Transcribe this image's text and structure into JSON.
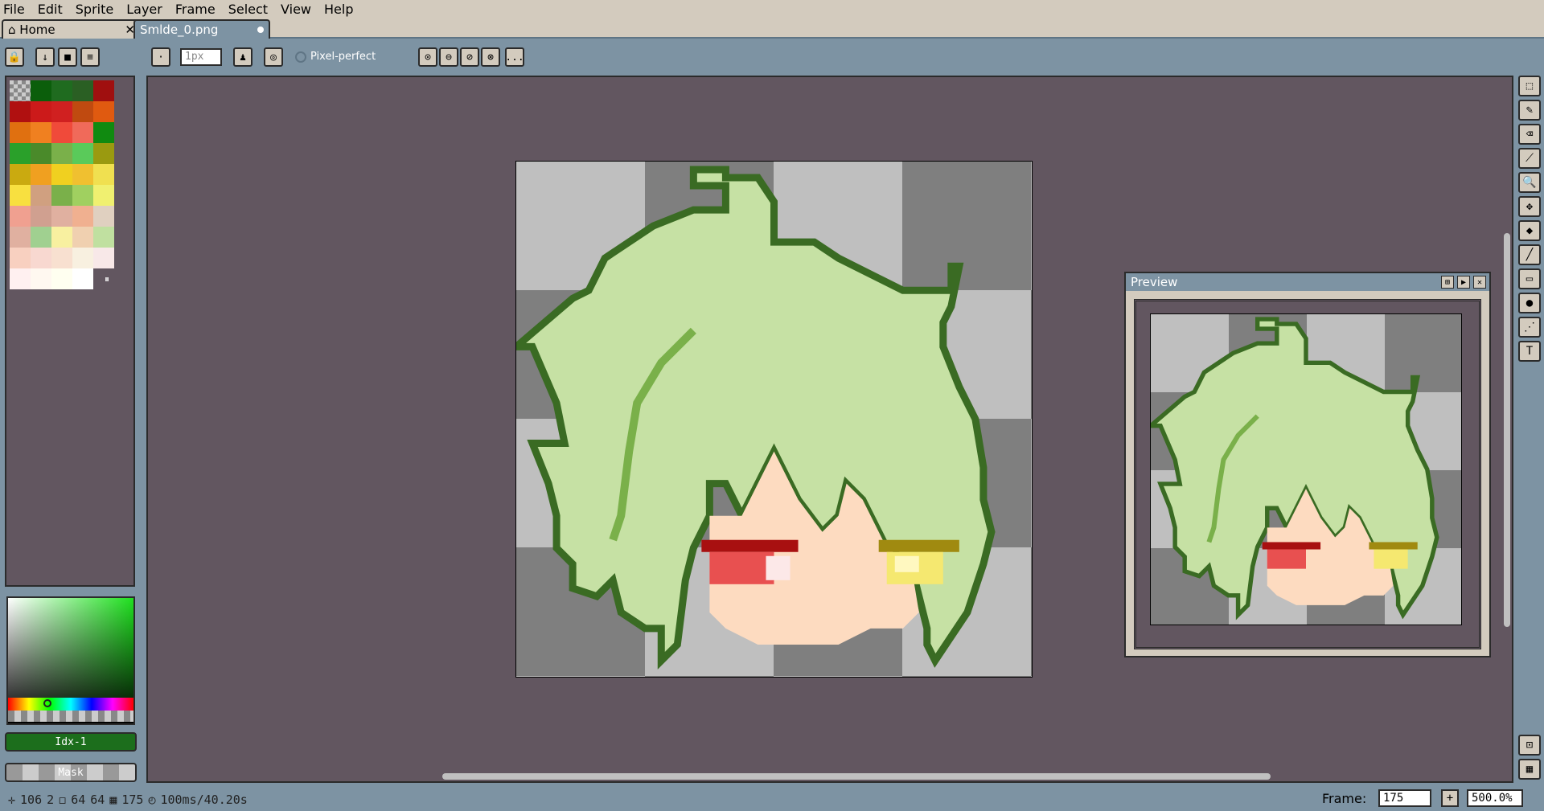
{
  "menu": {
    "items": [
      "File",
      "Edit",
      "Sprite",
      "Layer",
      "Frame",
      "Select",
      "View",
      "Help"
    ]
  },
  "tabs": {
    "home_label": "Home",
    "file_label": "Smlde_0.png",
    "home_close": "✕"
  },
  "toolbar": {
    "brush_size_placeholder": "1px",
    "pixel_perfect_label": "Pixel-perfect",
    "more_label": "..."
  },
  "palette": {
    "colors": [
      "#bfbfbf",
      "#0b5e0b",
      "#1f6b1f",
      "#2a5f23",
      "#a00f0f",
      "#b01010",
      "#cc1a1a",
      "#d02020",
      "#c04a10",
      "#e05a10",
      "#e07010",
      "#f08020",
      "#f04a3a",
      "#f06a5a",
      "#108a10",
      "#2aa02a",
      "#4a8a2a",
      "#7ab04a",
      "#5aca5a",
      "#9a9a10",
      "#caaa10",
      "#f0a020",
      "#f0d020",
      "#f0c030",
      "#f0e050",
      "#f8e040",
      "#d0a080",
      "#7ab04a",
      "#a0d060",
      "#f0f070",
      "#f0a090",
      "#d0a090",
      "#e0b0a0",
      "#f0b090",
      "#e0d0c0",
      "#e0b0a0",
      "#a0d090",
      "#f8f0a0",
      "#f0d0b0",
      "#c0e0a0",
      "#f8d0c0",
      "#f8d8d0",
      "#f8e0d0",
      "#f8f0e0",
      "#f8e8e8",
      "#fff0f0",
      "#fff8f0",
      "#fffff0",
      "#ffffff"
    ]
  },
  "color_panel": {
    "index_label": "Idx-1",
    "mask_label": "Mask"
  },
  "preview": {
    "title": "Preview"
  },
  "status": {
    "pos_x": "106",
    "pos_y": "2",
    "size_w": "64",
    "size_h": "64",
    "frame_number": "175",
    "duration": "100ms/40.20s"
  },
  "frame_control": {
    "label": "Frame:",
    "value": "175",
    "zoom": "500.0%"
  }
}
